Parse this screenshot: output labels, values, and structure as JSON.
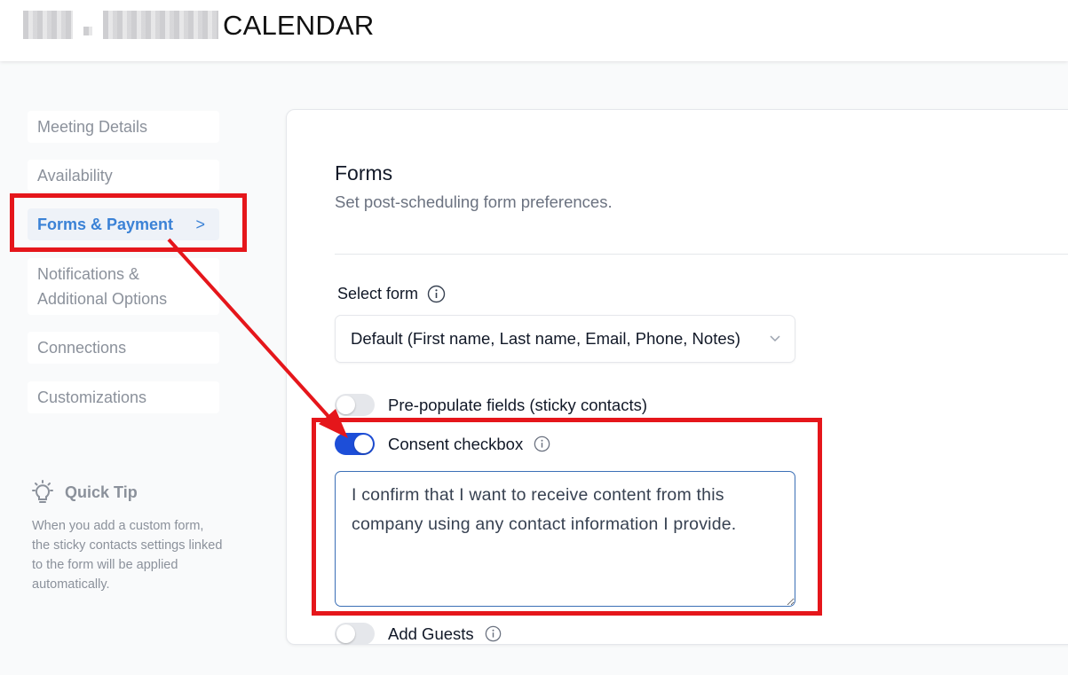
{
  "header": {
    "title": "CALENDAR"
  },
  "sidebar": {
    "items": [
      {
        "label": "Meeting Details"
      },
      {
        "label": "Availability"
      },
      {
        "label": "Forms & Payment",
        "active": true
      },
      {
        "label": "Notifications & Additional Options"
      },
      {
        "label": "Connections"
      },
      {
        "label": "Customizations"
      }
    ],
    "chevron": ">",
    "quick_tip": {
      "icon": "lightbulb-icon",
      "title": "Quick Tip",
      "text": "When you add a custom form, the sticky contacts settings linked to the form will be applied automatically."
    }
  },
  "forms": {
    "title": "Forms",
    "subtitle": "Set post-scheduling form preferences.",
    "select_form": {
      "label": "Select form",
      "value": "Default (First name, Last name, Email, Phone, Notes)"
    },
    "toggles": [
      {
        "label": "Pre-populate fields (sticky contacts)",
        "on": false,
        "info": false
      },
      {
        "label": "Consent checkbox",
        "on": true,
        "info": true
      },
      {
        "label": "Add Guests",
        "on": false,
        "info": true
      }
    ],
    "consent_text": "I confirm that I want to receive content from this company using any contact information I provide."
  },
  "colors": {
    "accent": "#1d4ed8",
    "active_nav_text": "#3b82d6",
    "annotation_red": "#e5161b"
  }
}
